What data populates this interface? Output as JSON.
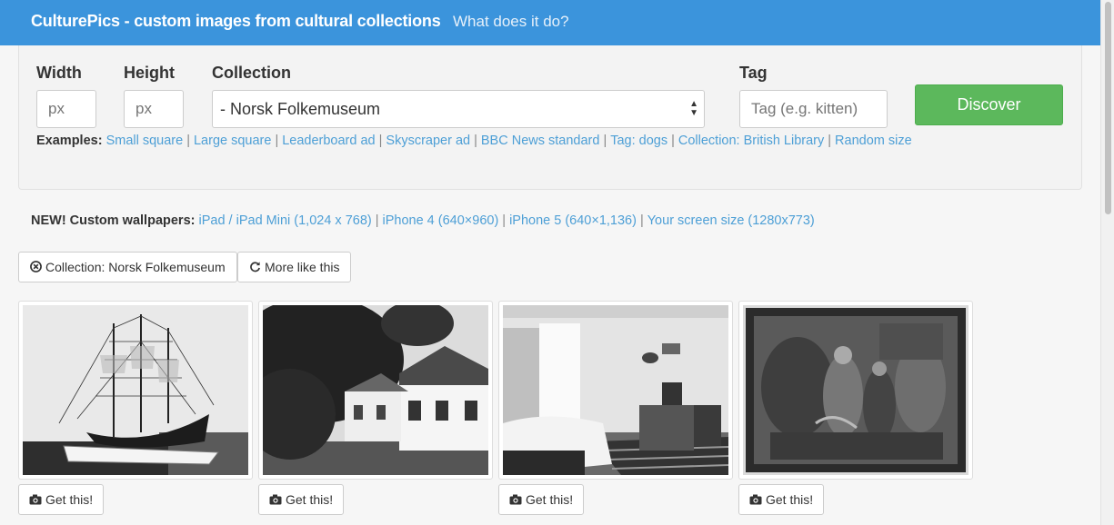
{
  "nav": {
    "brand": "CulturePics - custom images from cultural collections",
    "about_link": "What does it do?"
  },
  "form": {
    "width_label": "Width",
    "width_placeholder": "px",
    "height_label": "Height",
    "height_placeholder": "px",
    "collection_label": "Collection",
    "collection_selected": "- Norsk Folkemuseum",
    "tag_label": "Tag",
    "tag_placeholder": "Tag (e.g. kitten)",
    "discover_label": "Discover"
  },
  "examples": {
    "label": "Examples:",
    "links": [
      "Small square",
      "Large square",
      "Leaderboard ad",
      "Skyscraper ad",
      "BBC News standard",
      "Tag: dogs",
      "Collection: British Library",
      "Random size"
    ]
  },
  "wallpapers": {
    "label": "NEW! Custom wallpapers:",
    "links": [
      "iPad / iPad Mini (1,024 x 768)",
      "iPhone 4 (640×960)",
      "iPhone 5 (640×1,136)",
      "Your screen size (1280x773)"
    ]
  },
  "filters": {
    "collection_chip": "Collection: Norsk Folkemuseum",
    "more_like_this": "More like this"
  },
  "results": [
    {
      "subject": "ship model",
      "button": "Get this!"
    },
    {
      "subject": "white house with trees",
      "button": "Get this!"
    },
    {
      "subject": "bedroom interior",
      "button": "Get this!"
    },
    {
      "subject": "framed painting",
      "button": "Get this!"
    }
  ],
  "icons": {
    "remove": "times-circle-icon",
    "refresh": "refresh-icon",
    "camera": "camera-icon"
  },
  "colors": {
    "navbar": "#3b94dc",
    "discover": "#5cb85c",
    "link": "#4d9fd6"
  }
}
